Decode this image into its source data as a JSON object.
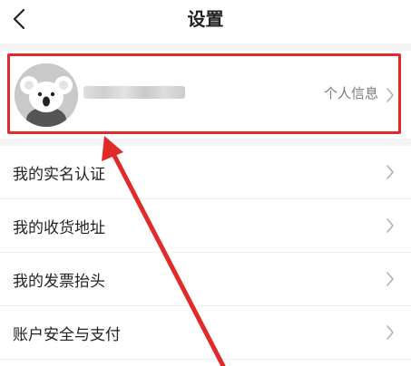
{
  "header": {
    "title": "设置",
    "back_icon": "chevron-left-icon"
  },
  "profile": {
    "info_label": "个人信息",
    "avatar": "koala-avatar"
  },
  "menu": [
    {
      "label": "我的实名认证"
    },
    {
      "label": "我的收货地址"
    },
    {
      "label": "我的发票抬头"
    },
    {
      "label": "账户安全与支付"
    }
  ],
  "annotation": {
    "highlight_color": "#e12a2a"
  }
}
